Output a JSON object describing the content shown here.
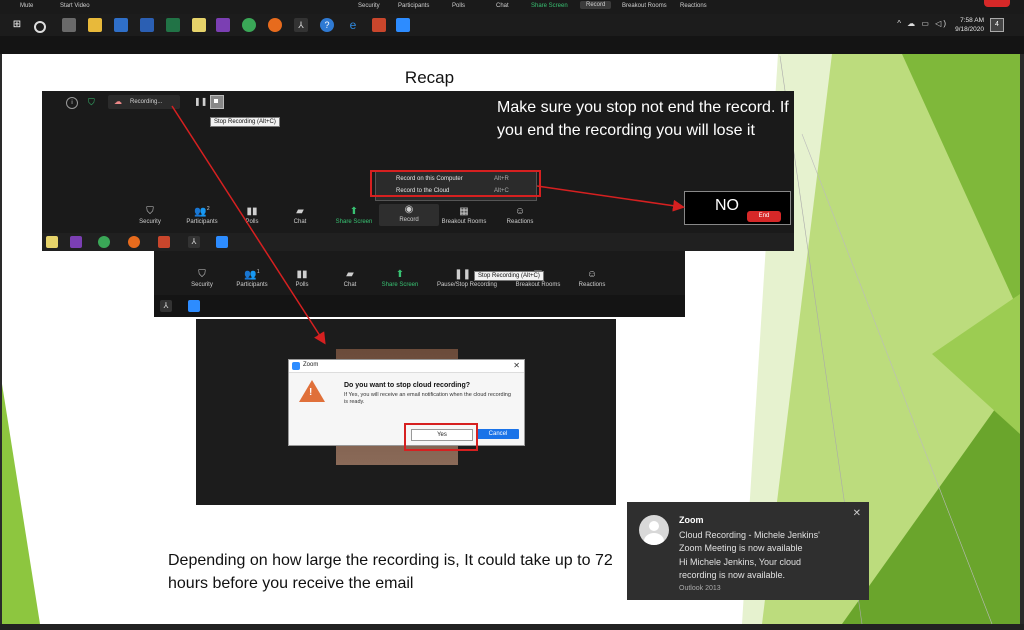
{
  "top_bar": {
    "mute": "Mute",
    "start_video": "Start Video",
    "security": "Security",
    "participants": "Participants",
    "polls": "Polls",
    "chat": "Chat",
    "share_screen": "Share Screen",
    "record": "Record",
    "breakout_rooms": "Breakout Rooms",
    "reactions": "Reactions"
  },
  "taskbar": {
    "time": "7:58 AM",
    "date": "9/18/2020",
    "notification_count": "4"
  },
  "slide": {
    "title": "Recap",
    "note": "Make sure you stop not end the record. If you end the recording you will lose it",
    "no_label": "NO",
    "end_label": "End",
    "bottom_text": "Depending on how large the recording is, It could take up to 72 hours before you receive the email"
  },
  "shot1": {
    "recording_label": "Recording...",
    "tooltip": "Stop Recording (Alt+C)",
    "menu": [
      {
        "label": "Record on this Computer",
        "shortcut": "Alt+R"
      },
      {
        "label": "Record to the Cloud",
        "shortcut": "Alt+C"
      }
    ],
    "participants_count": "2",
    "tools": {
      "security": "Security",
      "participants": "Participants",
      "polls": "Polls",
      "chat": "Chat",
      "share_screen": "Share Screen",
      "record": "Record",
      "breakout_rooms": "Breakout Rooms",
      "reactions": "Reactions"
    }
  },
  "shot2": {
    "tooltip": "Stop Recording (Alt+C)",
    "participants_count": "1",
    "tools": {
      "security": "Security",
      "participants": "Participants",
      "polls": "Polls",
      "chat": "Chat",
      "share_screen": "Share Screen",
      "pause_stop": "Pause/Stop Recording",
      "breakout_rooms": "Breakout Rooms",
      "reactions": "Reactions"
    }
  },
  "dialog": {
    "app": "Zoom",
    "heading": "Do you want to stop cloud recording?",
    "body": "If Yes, you will receive an email notification when the cloud recording is ready.",
    "yes": "Yes",
    "cancel": "Cancel"
  },
  "toast": {
    "app": "Zoom",
    "line1": "Cloud Recording - Michele Jenkins'",
    "line2": "Zoom Meeting is now available",
    "line3": "Hi Michele Jenkins,  Your cloud",
    "line4": "recording is now available.",
    "source": "Outlook 2013"
  },
  "colors": {
    "accent_green": "#38c172",
    "highlight_red": "#d62020",
    "slide_green": "#8dc63f"
  }
}
